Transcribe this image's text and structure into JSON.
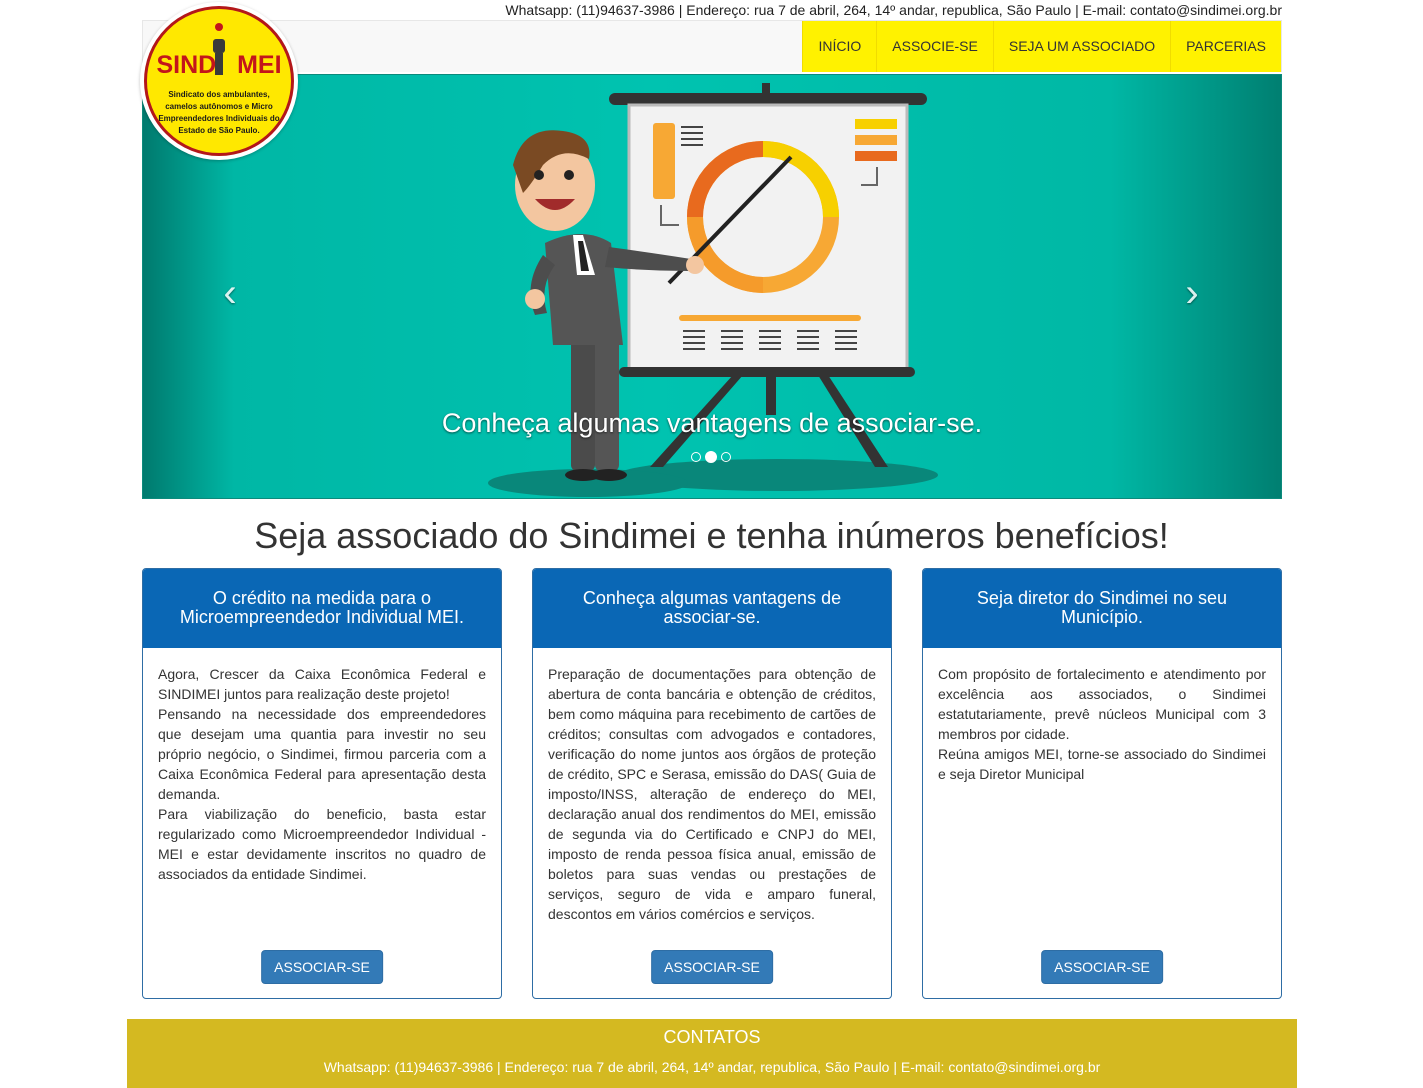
{
  "topbar": {
    "contact": "Whatsapp: (11)94637-3986 | Endereço: rua 7 de abril, 264, 14º andar, republica, São Paulo | E-mail: contato@sindimei.org.br"
  },
  "logo": {
    "word_left": "SIND",
    "word_right": "MEI",
    "subtitle": "Sindicato dos ambulantes, camelos autônomos e Micro Empreendedores Individuais do Estado de São Paulo."
  },
  "nav": {
    "items": [
      "INÍCIO",
      "ASSOCIE-SE",
      "SEJA UM ASSOCIADO",
      "PARCERIAS"
    ]
  },
  "carousel": {
    "caption": "Conheça algumas vantagens de associar-se.",
    "prev_icon": "chevron-left-icon",
    "next_icon": "chevron-right-icon",
    "prev_glyph": "‹",
    "next_glyph": "›",
    "slide_count": 3,
    "active_index": 1
  },
  "headline": "Seja associado do Sindimei e tenha inúmeros benefícios!",
  "panels": [
    {
      "title": "O crédito na medida para o Microempreendedor Individual MEI.",
      "paragraphs": [
        "Agora, Crescer da Caixa Econômica Federal e SINDIMEI juntos para realização deste projeto!",
        "Pensando na necessidade dos empreendedores que desejam uma quantia para investir no seu próprio negócio, o Sindimei, firmou parceria com a Caixa Econômica Federal para apresentação desta demanda.",
        "Para viabilização do beneficio, basta estar regularizado como Microempreendedor Individual - MEI e estar devidamente inscritos no quadro de associados da entidade Sindimei."
      ],
      "button": "ASSOCIAR-SE"
    },
    {
      "title": "Conheça algumas vantagens de associar-se.",
      "paragraphs": [
        "Preparação de documentações para obtenção de abertura de conta bancária e obtenção de créditos, bem como máquina para recebimento de cartões de créditos; consultas com advogados e contadores, verificação do nome juntos aos órgãos de proteção de crédito, SPC e Serasa, emissão do DAS( Guia de imposto/INSS, alteração de endereço do MEI, declaração anual dos rendimentos do MEI, emissão de segunda via do Certificado e CNPJ do MEI, imposto de renda pessoa física anual, emissão de boletos para suas vendas ou prestações de serviços, seguro de vida e amparo funeral, descontos em vários comércios e serviços."
      ],
      "button": "ASSOCIAR-SE"
    },
    {
      "title": "Seja diretor do Sindimei no seu Município.",
      "paragraphs": [
        "Com propósito de fortalecimento e atendimento por excelência aos associados, o Sindimei estatutariamente, prevê núcleos Municipal com 3 membros por cidade.",
        "Reúna amigos MEI, torne-se associado do Sindimei e seja Diretor Municipal"
      ],
      "button": "ASSOCIAR-SE"
    }
  ],
  "footer": {
    "title": "CONTATOS",
    "contact": "Whatsapp: (11)94637-3986 | Endereço: rua 7 de abril, 264, 14º andar, republica, São Paulo | E-mail: contato@sindimei.org.br"
  },
  "colors": {
    "nav_yellow": "#fff200",
    "panel_blue": "#0a67b5",
    "button_blue": "#337ab7",
    "footer_gold": "#d4b921",
    "carousel_teal": "#00c3b0",
    "logo_red": "#c3151b"
  }
}
